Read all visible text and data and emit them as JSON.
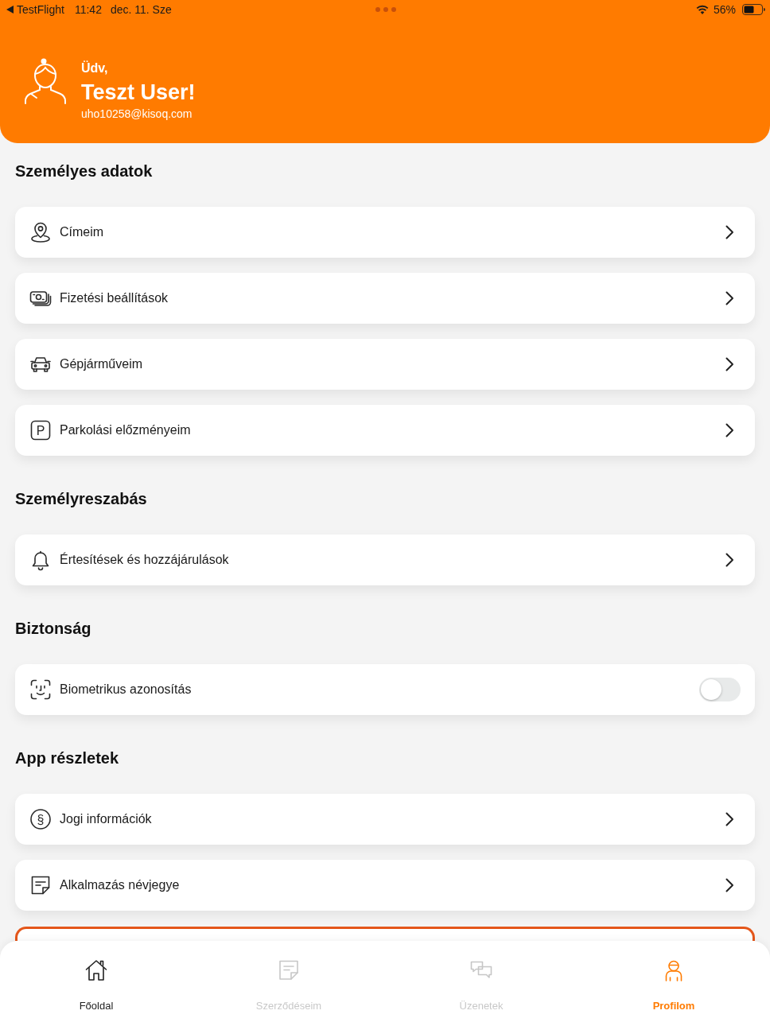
{
  "status_bar": {
    "back_label": "TestFlight",
    "time": "11:42",
    "date": "dec. 11. Sze",
    "battery": "56%"
  },
  "header": {
    "greeting": "Üdv,",
    "name": "Teszt User!",
    "email": "uho10258@kisoq.com"
  },
  "sections": [
    {
      "title": "Személyes adatok",
      "items": [
        {
          "kind": "link",
          "label": "Címeim"
        },
        {
          "kind": "link",
          "label": "Fizetési beállítások"
        },
        {
          "kind": "link",
          "label": "Gépjárműveim"
        },
        {
          "kind": "link",
          "label": "Parkolási előzményeim",
          "icon_text": "P"
        }
      ]
    },
    {
      "title": "Személyreszabás",
      "items": [
        {
          "kind": "link",
          "label": "Értesítések és hozzájárulások"
        }
      ]
    },
    {
      "title": "Biztonság",
      "items": [
        {
          "kind": "toggle",
          "label": "Biometrikus azonosítás",
          "on": false
        }
      ]
    },
    {
      "title": "App részletek",
      "items": [
        {
          "kind": "link",
          "label": "Jogi információk",
          "icon_text": "§"
        },
        {
          "kind": "link",
          "label": "Alkalmazás névjegye"
        }
      ]
    }
  ],
  "tabs": [
    {
      "label": "Főoldal",
      "selected": false,
      "disabled": false
    },
    {
      "label": "Szerződéseim",
      "selected": false,
      "disabled": true
    },
    {
      "label": "Üzenetek",
      "selected": false,
      "disabled": true
    },
    {
      "label": "Profilom",
      "selected": true,
      "disabled": false
    }
  ]
}
